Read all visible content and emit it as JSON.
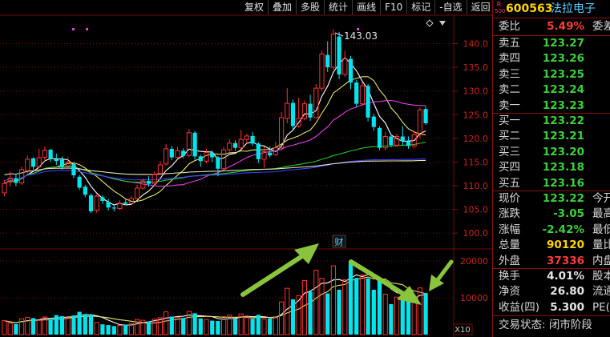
{
  "toolbar": {
    "buttons": [
      "复权",
      "叠加",
      "多股",
      "统计",
      "画线",
      "F10",
      "标记",
      "-自选",
      "返回"
    ]
  },
  "chart": {
    "high_label": "143.03",
    "finance_marker": "财",
    "price_ticks": [
      "140.0",
      "135.0",
      "130.0",
      "125.0",
      "120.0",
      "115.0",
      "110.0",
      "105.0",
      "100.0"
    ],
    "volume_ticks": [
      "20000",
      "10000"
    ],
    "volume_unit": "X10",
    "colors": {
      "up": "#ff3232",
      "down": "#00e5ee",
      "grid": "#7a0a0a",
      "arrow": "#8ac43c",
      "ma5": "#ffffff",
      "ma10": "#e6e66a",
      "ma20": "#e040e0",
      "ma60": "#28c828",
      "ma120": "#3c3cff",
      "ma250": "#e6e6b4"
    }
  },
  "chart_data": {
    "type": "candlestick",
    "ylim": [
      97,
      146
    ],
    "yticks": [
      100,
      105,
      110,
      115,
      120,
      125,
      130,
      135,
      140
    ],
    "high_marker": 143.03,
    "candles": [
      {
        "o": 108.5,
        "c": 110.5,
        "h": 111.2,
        "l": 107.8,
        "v": 3800
      },
      {
        "o": 110.8,
        "c": 111.6,
        "h": 113.0,
        "l": 109.8,
        "v": 3100
      },
      {
        "o": 111.6,
        "c": 110.6,
        "h": 112.5,
        "l": 109.9,
        "v": 2900
      },
      {
        "o": 110.6,
        "c": 113.4,
        "h": 114.0,
        "l": 110.2,
        "v": 4300
      },
      {
        "o": 113.2,
        "c": 115.6,
        "h": 116.4,
        "l": 112.6,
        "v": 4700
      },
      {
        "o": 115.8,
        "c": 114.0,
        "h": 116.0,
        "l": 113.4,
        "v": 4500
      },
      {
        "o": 114.0,
        "c": 115.9,
        "h": 117.8,
        "l": 113.8,
        "v": 3900
      },
      {
        "o": 116.0,
        "c": 117.5,
        "h": 118.3,
        "l": 115.2,
        "v": 4800
      },
      {
        "o": 117.6,
        "c": 115.7,
        "h": 117.8,
        "l": 115.0,
        "v": 4200
      },
      {
        "o": 115.6,
        "c": 115.2,
        "h": 116.8,
        "l": 114.4,
        "v": 5300
      },
      {
        "o": 115.5,
        "c": 114.0,
        "h": 116.2,
        "l": 113.4,
        "v": 5000
      },
      {
        "o": 114.2,
        "c": 115.0,
        "h": 116.0,
        "l": 113.8,
        "v": 4600
      },
      {
        "o": 114.6,
        "c": 112.2,
        "h": 114.8,
        "l": 111.6,
        "v": 5200
      },
      {
        "o": 111.9,
        "c": 109.6,
        "h": 112.3,
        "l": 109.1,
        "v": 6200
      },
      {
        "o": 109.8,
        "c": 108.1,
        "h": 110.2,
        "l": 107.6,
        "v": 5600
      },
      {
        "o": 108.0,
        "c": 104.6,
        "h": 108.4,
        "l": 104.2,
        "v": 5400
      },
      {
        "o": 104.8,
        "c": 107.8,
        "h": 108.2,
        "l": 104.3,
        "v": 3300
      },
      {
        "o": 107.6,
        "c": 106.8,
        "h": 108.0,
        "l": 106.2,
        "v": 2800
      },
      {
        "o": 106.6,
        "c": 105.4,
        "h": 107.2,
        "l": 104.8,
        "v": 2600
      },
      {
        "o": 105.4,
        "c": 105.2,
        "h": 106.0,
        "l": 104.6,
        "v": 2300
      },
      {
        "o": 105.2,
        "c": 106.3,
        "h": 106.9,
        "l": 104.9,
        "v": 2500
      },
      {
        "o": 106.5,
        "c": 106.2,
        "h": 107.2,
        "l": 105.9,
        "v": 2700
      },
      {
        "o": 106.3,
        "c": 107.3,
        "h": 107.9,
        "l": 106.0,
        "v": 3000
      },
      {
        "o": 107.3,
        "c": 109.5,
        "h": 110.2,
        "l": 107.1,
        "v": 4100
      },
      {
        "o": 109.5,
        "c": 111.0,
        "h": 111.5,
        "l": 109.2,
        "v": 3900
      },
      {
        "o": 111.0,
        "c": 110.4,
        "h": 112.0,
        "l": 109.8,
        "v": 3600
      },
      {
        "o": 110.4,
        "c": 112.4,
        "h": 113.0,
        "l": 110.1,
        "v": 4200
      },
      {
        "o": 112.6,
        "c": 114.4,
        "h": 115.2,
        "l": 112.3,
        "v": 4600
      },
      {
        "o": 114.6,
        "c": 117.8,
        "h": 118.8,
        "l": 114.2,
        "v": 6200
      },
      {
        "o": 117.8,
        "c": 116.0,
        "h": 118.4,
        "l": 115.4,
        "v": 4900
      },
      {
        "o": 116.0,
        "c": 117.4,
        "h": 118.2,
        "l": 115.6,
        "v": 4700
      },
      {
        "o": 117.4,
        "c": 116.3,
        "h": 117.9,
        "l": 115.8,
        "v": 4500
      },
      {
        "o": 116.4,
        "c": 121.2,
        "h": 122.0,
        "l": 116.0,
        "v": 6300
      },
      {
        "o": 121.2,
        "c": 116.2,
        "h": 121.6,
        "l": 115.5,
        "v": 5800
      },
      {
        "o": 116.2,
        "c": 115.2,
        "h": 116.6,
        "l": 114.0,
        "v": 4400
      },
      {
        "o": 115.2,
        "c": 117.0,
        "h": 117.8,
        "l": 114.7,
        "v": 4100
      },
      {
        "o": 117.0,
        "c": 116.0,
        "h": 117.5,
        "l": 115.0,
        "v": 3800
      },
      {
        "o": 116.0,
        "c": 113.6,
        "h": 116.3,
        "l": 112.0,
        "v": 3700
      },
      {
        "o": 113.6,
        "c": 117.6,
        "h": 118.2,
        "l": 113.3,
        "v": 4900
      },
      {
        "o": 117.6,
        "c": 119.0,
        "h": 119.8,
        "l": 117.2,
        "v": 5300
      },
      {
        "o": 119.0,
        "c": 118.0,
        "h": 119.6,
        "l": 117.4,
        "v": 4300
      },
      {
        "o": 118.0,
        "c": 119.8,
        "h": 121.8,
        "l": 117.8,
        "v": 5600
      },
      {
        "o": 119.8,
        "c": 120.5,
        "h": 121.0,
        "l": 118.9,
        "v": 4800
      },
      {
        "o": 120.5,
        "c": 118.9,
        "h": 121.3,
        "l": 118.4,
        "v": 4300
      },
      {
        "o": 118.9,
        "c": 115.6,
        "h": 119.2,
        "l": 114.8,
        "v": 5400
      },
      {
        "o": 115.6,
        "c": 117.2,
        "h": 118.3,
        "l": 113.8,
        "v": 4200
      },
      {
        "o": 117.0,
        "c": 116.4,
        "h": 118.3,
        "l": 116.0,
        "v": 4400
      },
      {
        "o": 116.6,
        "c": 118.0,
        "h": 119.3,
        "l": 116.3,
        "v": 4600
      },
      {
        "o": 118.0,
        "c": 124.4,
        "h": 125.6,
        "l": 117.5,
        "v": 8900
      },
      {
        "o": 124.2,
        "c": 127.4,
        "h": 130.6,
        "l": 123.2,
        "v": 12600
      },
      {
        "o": 127.5,
        "c": 122.6,
        "h": 128.2,
        "l": 121.9,
        "v": 9600
      },
      {
        "o": 122.6,
        "c": 124.2,
        "h": 128.6,
        "l": 122.2,
        "v": 10600
      },
      {
        "o": 124.2,
        "c": 127.3,
        "h": 128.0,
        "l": 123.8,
        "v": 14700
      },
      {
        "o": 127.3,
        "c": 124.4,
        "h": 129.2,
        "l": 123.7,
        "v": 11700
      },
      {
        "o": 124.4,
        "c": 130.6,
        "h": 131.5,
        "l": 124.2,
        "v": 17500
      },
      {
        "o": 130.6,
        "c": 137.8,
        "h": 138.5,
        "l": 130.0,
        "v": 15300
      },
      {
        "o": 137.6,
        "c": 135.0,
        "h": 140.5,
        "l": 134.0,
        "v": 11200
      },
      {
        "o": 135.0,
        "c": 142.0,
        "h": 143.03,
        "l": 134.5,
        "v": 18700
      },
      {
        "o": 141.5,
        "c": 133.5,
        "h": 142.5,
        "l": 132.5,
        "v": 12200
      },
      {
        "o": 133.5,
        "c": 136.8,
        "h": 138.5,
        "l": 133.0,
        "v": 14900
      },
      {
        "o": 136.8,
        "c": 131.8,
        "h": 137.4,
        "l": 130.4,
        "v": 20000
      },
      {
        "o": 131.8,
        "c": 127.3,
        "h": 132.3,
        "l": 126.6,
        "v": 15400
      },
      {
        "o": 127.3,
        "c": 131.1,
        "h": 132.0,
        "l": 126.8,
        "v": 16200
      },
      {
        "o": 131.1,
        "c": 124.4,
        "h": 131.5,
        "l": 123.6,
        "v": 15300
      },
      {
        "o": 124.6,
        "c": 122.4,
        "h": 125.2,
        "l": 121.6,
        "v": 12200
      },
      {
        "o": 122.2,
        "c": 118.0,
        "h": 122.6,
        "l": 117.5,
        "v": 15300
      },
      {
        "o": 118.0,
        "c": 120.4,
        "h": 121.3,
        "l": 117.4,
        "v": 11000
      },
      {
        "o": 120.4,
        "c": 118.6,
        "h": 121.0,
        "l": 118.1,
        "v": 8300
      },
      {
        "o": 118.6,
        "c": 120.4,
        "h": 121.0,
        "l": 118.2,
        "v": 10200
      },
      {
        "o": 120.4,
        "c": 119.4,
        "h": 122.6,
        "l": 118.6,
        "v": 11700
      },
      {
        "o": 119.4,
        "c": 118.4,
        "h": 120.4,
        "l": 117.8,
        "v": 9100
      },
      {
        "o": 118.4,
        "c": 120.8,
        "h": 121.6,
        "l": 117.9,
        "v": 9700
      },
      {
        "o": 120.8,
        "c": 126.0,
        "h": 126.5,
        "l": 120.0,
        "v": 12700
      },
      {
        "o": 126.2,
        "c": 123.2,
        "h": 126.8,
        "l": 122.8,
        "v": 11300
      }
    ]
  },
  "quote": {
    "header": {
      "flag_top": "R",
      "flag_bottom": "500",
      "code": "600563",
      "name": "法拉电子"
    },
    "weibi": {
      "label": "委比",
      "value": "5.49%",
      "label2": "委差"
    },
    "asks": [
      {
        "label": "卖五",
        "price": "123.27"
      },
      {
        "label": "卖四",
        "price": "123.26"
      },
      {
        "label": "卖三",
        "price": "123.25"
      },
      {
        "label": "卖二",
        "price": "123.24"
      },
      {
        "label": "卖一",
        "price": "123.23"
      }
    ],
    "bids": [
      {
        "label": "买一",
        "price": "123.22"
      },
      {
        "label": "买二",
        "price": "123.21"
      },
      {
        "label": "买三",
        "price": "123.20"
      },
      {
        "label": "买四",
        "price": "123.18"
      },
      {
        "label": "买五",
        "price": "123.16"
      }
    ],
    "stats": [
      {
        "label": "现价",
        "value": "123.22",
        "color": "green",
        "label2": "今开"
      },
      {
        "label": "涨跌",
        "value": "-3.05",
        "color": "green",
        "label2": "最高"
      },
      {
        "label": "涨幅",
        "value": "-2.42%",
        "color": "green",
        "label2": "最低"
      },
      {
        "label": "总量",
        "value": "90120",
        "color": "yellow",
        "label2": "量比"
      },
      {
        "label": "外盘",
        "value": "37336",
        "color": "red",
        "label2": "内盘"
      }
    ],
    "stats2": [
      {
        "label": "换手",
        "value": "4.01%",
        "color": "white",
        "label2": "股本"
      },
      {
        "label": "净资",
        "value": "26.80",
        "color": "white",
        "label2": "流通"
      },
      {
        "label": "收益(四)",
        "value": "5.300",
        "color": "white",
        "label2": "PE(动)"
      }
    ],
    "status": "交易状态: 闭市阶段"
  }
}
